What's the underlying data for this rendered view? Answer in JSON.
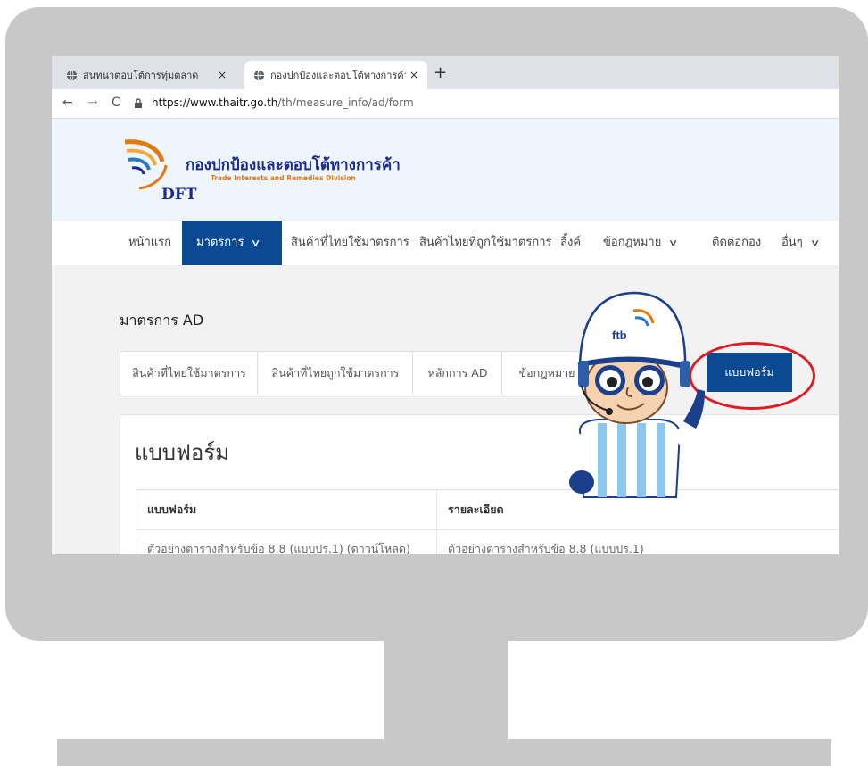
{
  "browser": {
    "tabs": [
      {
        "label": "สนทนาตอบโต้การทุ่มตลาด",
        "active": false
      },
      {
        "label": "กองปกป้องและตอบโต้ทางการค้า กรมการ",
        "active": true
      }
    ],
    "tab_close": "×",
    "new_tab": "+",
    "nav": {
      "back": "←",
      "forward": "→",
      "reload": "C"
    },
    "url_domain": "https://www.thaitr.go.th",
    "url_path": "/th/measure_info/ad/form"
  },
  "site": {
    "name_thai": "กองปกป้องและตอบโต้ทางการค้า",
    "name_en": "Trade Interests and Remedies Division",
    "abbr": "DFT",
    "colors": {
      "brand_blue": "#0b4a92",
      "accent_orange": "#e07a14",
      "highlight_red": "#e01b22"
    }
  },
  "nav": {
    "items": [
      {
        "label": "หน้าแรก",
        "active": false,
        "dropdown": false
      },
      {
        "label": "มาตรการ",
        "active": true,
        "dropdown": true
      },
      {
        "label": "สินค้าที่ไทยใช้มาตรการ",
        "active": false,
        "dropdown": false
      },
      {
        "label": "สินค้าไทยที่ถูกใช้มาตรการ",
        "active": false,
        "dropdown": false
      },
      {
        "label": "ลิ้งค์",
        "active": false,
        "dropdown": false
      },
      {
        "label": "ข้อกฎหมาย",
        "active": false,
        "dropdown": true
      },
      {
        "label": "ติดต่อกอง",
        "active": false,
        "dropdown": false
      },
      {
        "label": "อื่นๆ",
        "active": false,
        "dropdown": true
      }
    ],
    "chevron": "∨"
  },
  "page": {
    "title": "มาตรการ AD",
    "subtabs": [
      {
        "label": "สินค้าที่ไทยใช้มาตรการ",
        "active": false
      },
      {
        "label": "สินค้าที่ไทยถูกใช้มาตรการ",
        "active": false
      },
      {
        "label": "หลักการ AD",
        "active": false
      },
      {
        "label": "ข้อกฎหมาย",
        "active": false
      },
      {
        "label": "แบบฟอร์ม",
        "active": true
      }
    ],
    "card_title": "แบบฟอร์ม",
    "table": {
      "headers": [
        "แบบฟอร์ม",
        "รายละเอียด"
      ],
      "rows": [
        [
          "ตัวอย่างตารางสำหรับข้อ 8.8 (แบบปร.1) (ดาวน์โหลด)",
          "ตัวอย่างตารางสำหรับข้อ 8.8 (แบบปร.1)"
        ]
      ]
    }
  },
  "mascot": {
    "helmet_text": "ftb"
  }
}
